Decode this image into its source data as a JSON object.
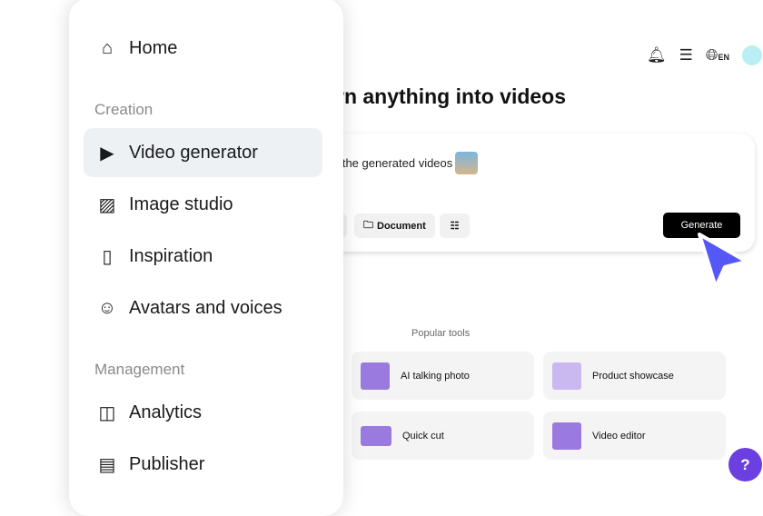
{
  "header": {
    "title": "rn anything into videos",
    "language": "EN"
  },
  "prompt": {
    "text": "n the generated videos",
    "document_label": "Document",
    "generate_label": "Generate"
  },
  "popular": {
    "heading": "Popular tools",
    "tools": [
      {
        "label": "AI talking photo"
      },
      {
        "label": "Product showcase"
      },
      {
        "label": "Quick cut"
      },
      {
        "label": "Video editor"
      }
    ]
  },
  "sidebar": {
    "home": "Home",
    "creation": "Creation",
    "management": "Management",
    "items": [
      {
        "label": "Video generator"
      },
      {
        "label": "Image studio"
      },
      {
        "label": "Inspiration"
      },
      {
        "label": "Avatars and voices"
      },
      {
        "label": "Analytics"
      },
      {
        "label": "Publisher"
      }
    ]
  },
  "colors": {
    "accent": "#5458f7",
    "help": "#6b3fe0"
  }
}
